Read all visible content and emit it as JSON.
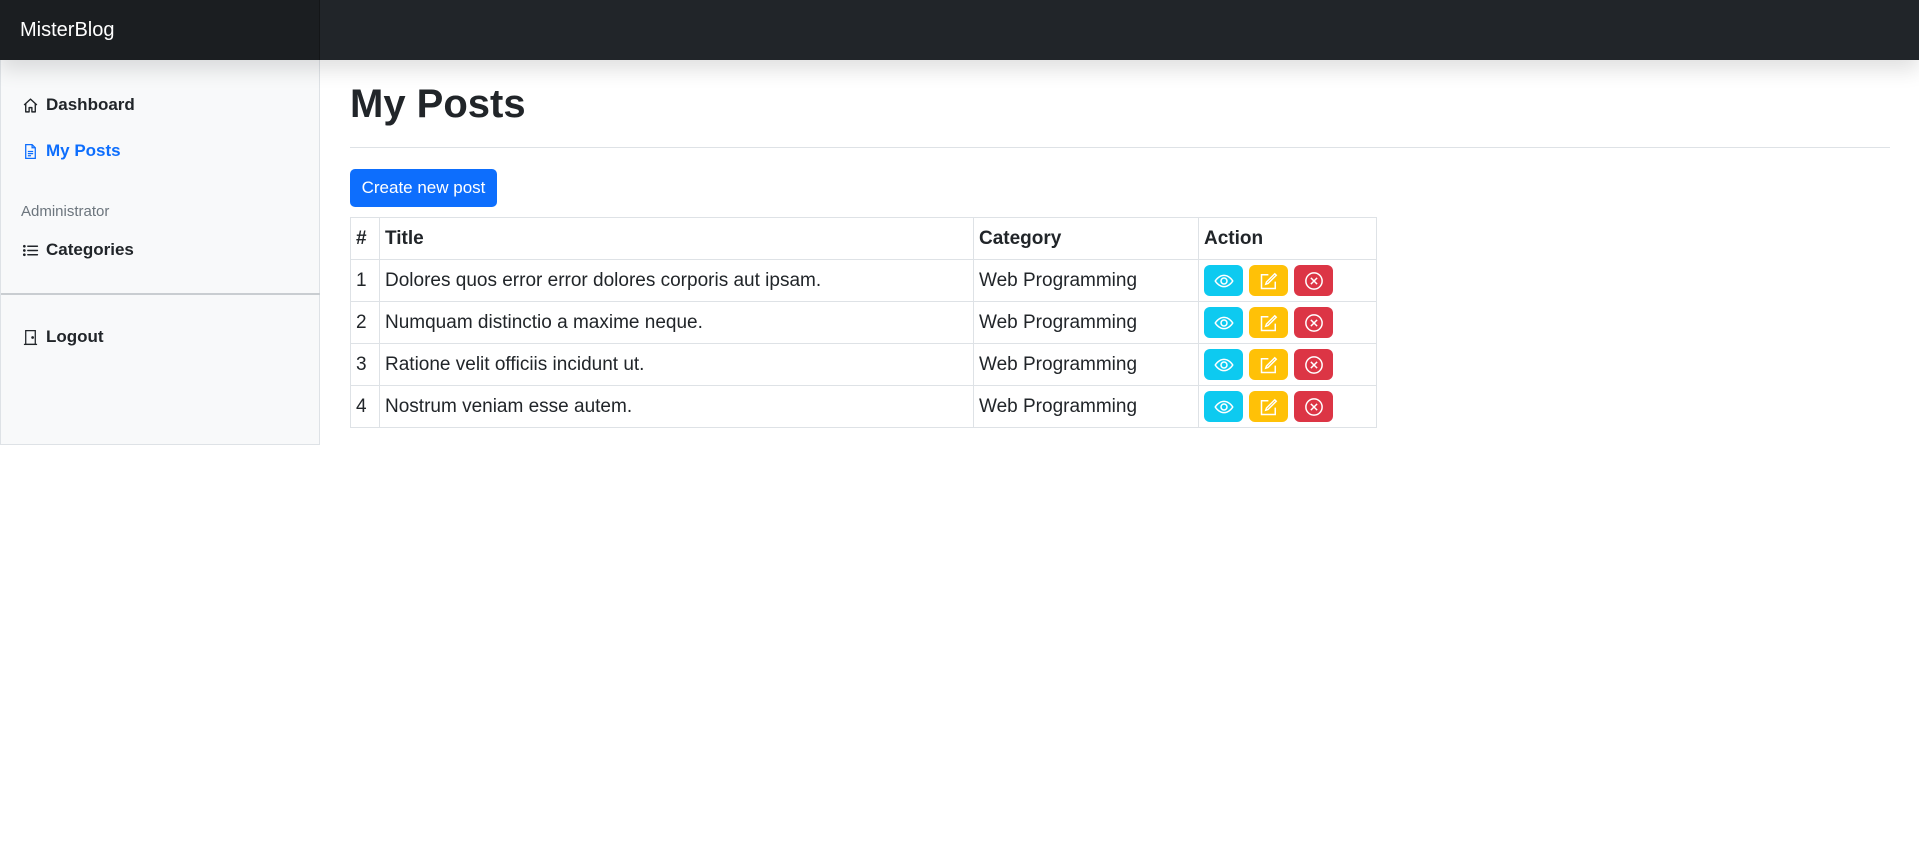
{
  "app": {
    "brand": "MisterBlog"
  },
  "sidebar": {
    "items": [
      {
        "label": "Dashboard",
        "icon": "home-icon"
      },
      {
        "label": "My Posts",
        "icon": "file-text-icon",
        "active": true
      }
    ],
    "admin_heading": "Administrator",
    "admin_items": [
      {
        "label": "Categories",
        "icon": "list-icon"
      }
    ],
    "footer_items": [
      {
        "label": "Logout",
        "icon": "door-icon"
      }
    ]
  },
  "main": {
    "title": "My Posts",
    "create_button": "Create new post",
    "table": {
      "headers": [
        "#",
        "Title",
        "Category",
        "Action"
      ],
      "rows": [
        {
          "num": "1",
          "title": "Dolores quos error error dolores corporis aut ipsam.",
          "category": "Web Programming"
        },
        {
          "num": "2",
          "title": "Numquam distinctio a maxime neque.",
          "category": "Web Programming"
        },
        {
          "num": "3",
          "title": "Ratione velit officiis incidunt ut.",
          "category": "Web Programming"
        },
        {
          "num": "4",
          "title": "Nostrum veniam esse autem.",
          "category": "Web Programming"
        }
      ],
      "actions": [
        {
          "name": "view-button",
          "icon": "eye-icon",
          "color": "#0dcaf0"
        },
        {
          "name": "edit-button",
          "icon": "pencil-square-icon",
          "color": "#ffc107"
        },
        {
          "name": "delete-button",
          "icon": "x-circle-icon",
          "color": "#dc3545"
        }
      ]
    }
  },
  "colors": {
    "topbar": "#212529",
    "primary": "#0d6efd",
    "info": "#0dcaf0",
    "warning": "#ffc107",
    "danger": "#dc3545",
    "sidebar_bg": "#f8f9fa"
  }
}
